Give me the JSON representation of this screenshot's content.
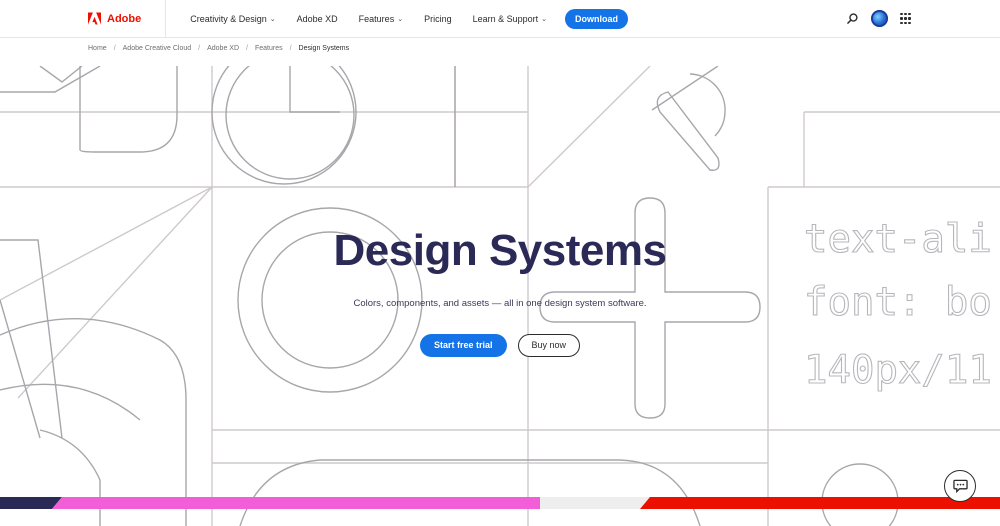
{
  "nav": {
    "brand": "Adobe",
    "links": [
      {
        "label": "Creativity & Design",
        "dropdown": true
      },
      {
        "label": "Adobe XD",
        "dropdown": false
      },
      {
        "label": "Features",
        "dropdown": true
      },
      {
        "label": "Pricing",
        "dropdown": false
      },
      {
        "label": "Learn & Support",
        "dropdown": true
      }
    ],
    "download_label": "Download",
    "icons": [
      "adobe-logo-icon",
      "search-icon",
      "avatar",
      "apps-grid-icon"
    ]
  },
  "breadcrumb": [
    "Home",
    "Adobe Creative Cloud",
    "Adobe XD",
    "Features",
    "Design Systems"
  ],
  "hero": {
    "title": "Design Systems",
    "subtitle": "Colors, components, and assets — all in one design system software.",
    "primary_cta": "Start free trial",
    "secondary_cta": "Buy now",
    "background_code": [
      "text-ali",
      "font: bo",
      "140px/11"
    ]
  },
  "chat": {
    "icon": "chat-icon"
  },
  "colors": {
    "accent_blue": "#1473e6",
    "adobe_red": "#eb1000",
    "title_navy": "#2b2a56",
    "stripe_pink": "#f25ed8",
    "stripe_red": "#eb1000",
    "stripe_navy": "#2b2a56"
  }
}
